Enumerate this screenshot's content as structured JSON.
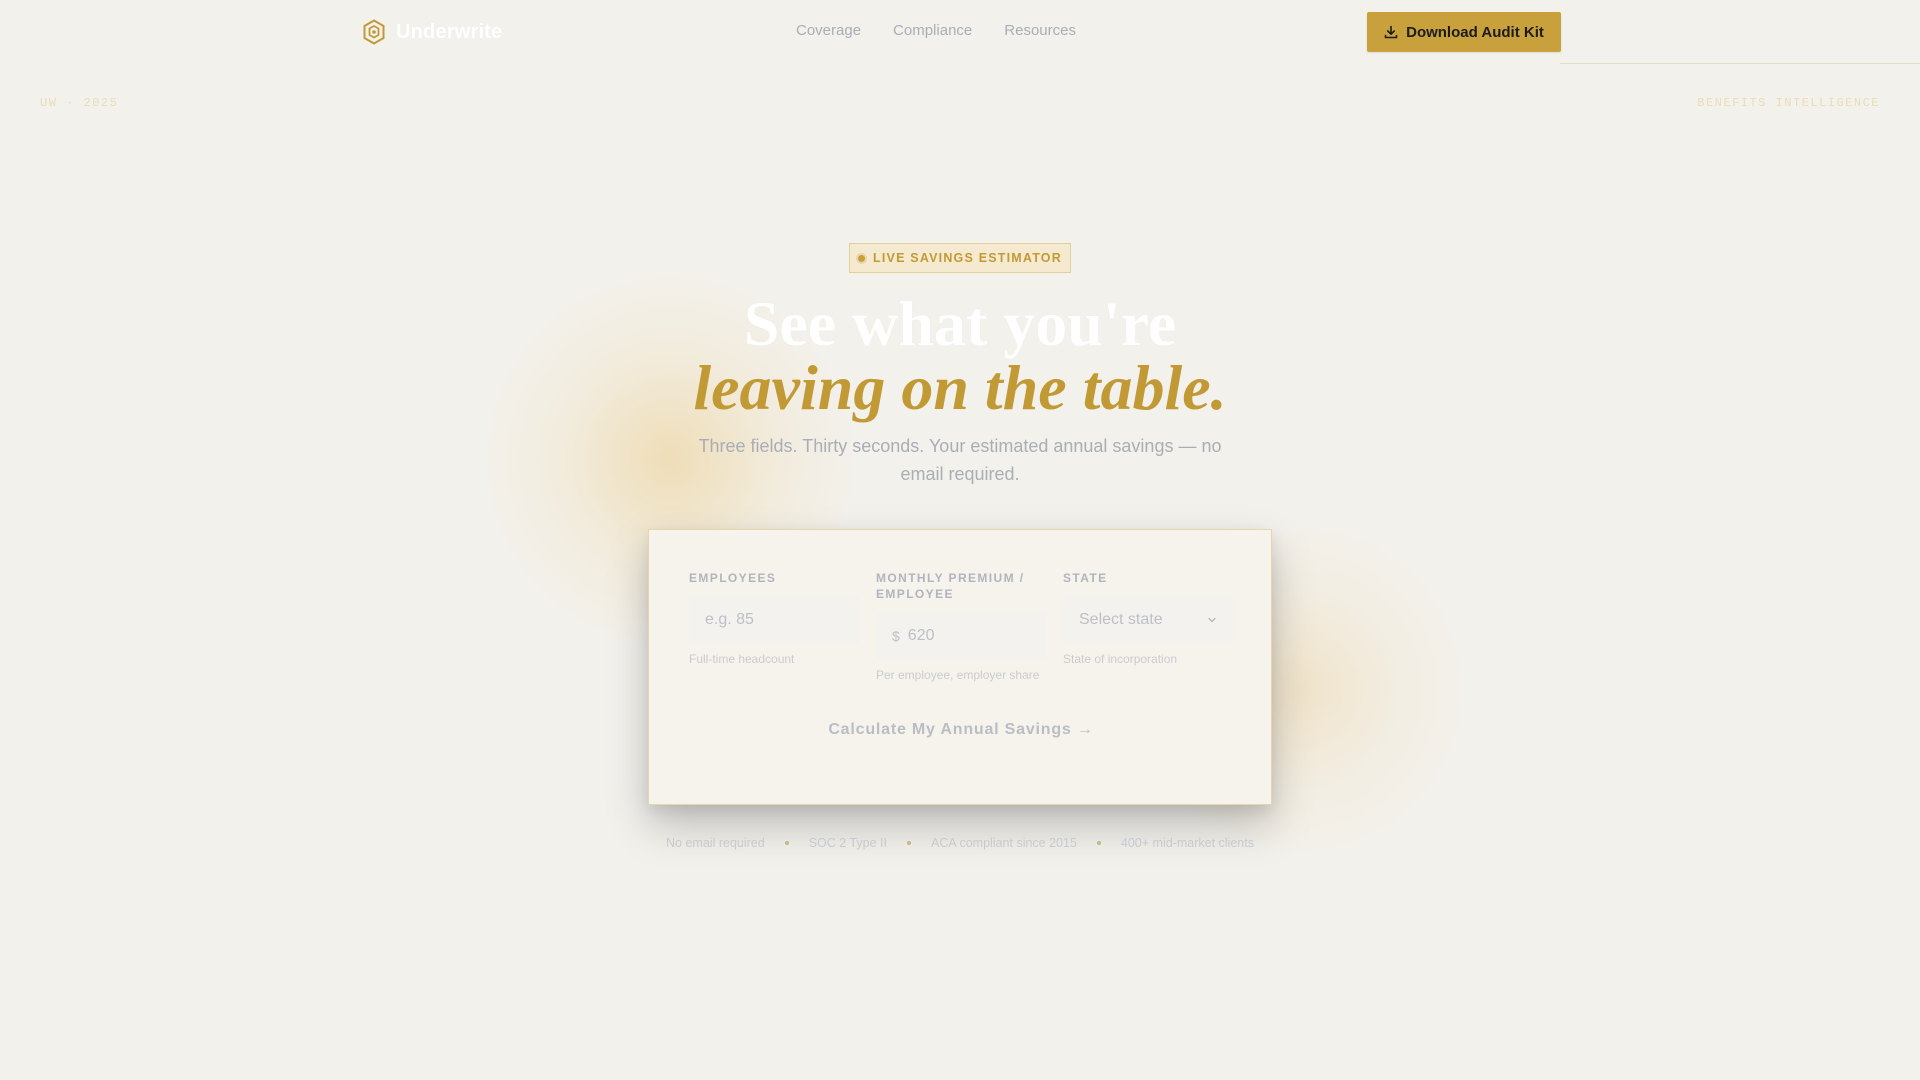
{
  "header": {
    "brand": "Underwrite",
    "nav": [
      "Coverage",
      "Compliance",
      "Resources"
    ],
    "cta_label": "Download Audit Kit"
  },
  "corners": {
    "left": "UW · 2025",
    "right": "BENEFITS INTELLIGENCE"
  },
  "hero": {
    "badge": "LIVE SAVINGS ESTIMATOR",
    "headline_line1": "See what you're",
    "headline_line2": "leaving on the table.",
    "subtitle": "Three fields. Thirty seconds. Your estimated annual savings — no email required."
  },
  "form": {
    "employees": {
      "label": "EMPLOYEES",
      "placeholder": "e.g. 85",
      "hint": "Full-time headcount"
    },
    "premium": {
      "label": "MONTHLY PREMIUM / EMPLOYEE",
      "currency": "$",
      "placeholder": "620",
      "hint": "Per employee, employer share"
    },
    "state": {
      "label": "STATE",
      "selected": "Select state",
      "hint": "State of incorporation"
    },
    "submit_label": "Calculate My Annual Savings →"
  },
  "trust": [
    "No email required",
    "SOC 2 Type II",
    "ACA compliant since 2015",
    "400+ mid-market clients"
  ],
  "colors": {
    "background": "#f3f1ec",
    "accent": "#c9a13c",
    "accent_text": "#c29a35"
  }
}
